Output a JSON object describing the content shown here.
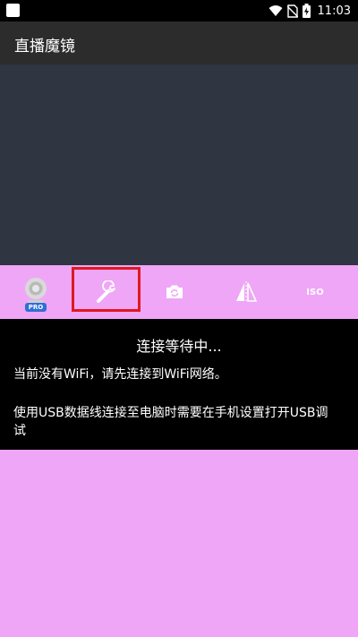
{
  "status_bar": {
    "time": "11:03",
    "icons": [
      "wifi-icon",
      "no-sim-icon",
      "battery-charging-icon"
    ]
  },
  "app_bar": {
    "title": "直播魔镜"
  },
  "toolbar": {
    "items": [
      {
        "name": "webcam-pro-icon",
        "badge": "PRO"
      },
      {
        "name": "wrench-icon",
        "selected": true
      },
      {
        "name": "camera-switch-icon"
      },
      {
        "name": "mirror-flip-icon"
      },
      {
        "name": "iso-button",
        "label": "ISO"
      }
    ],
    "highlight_color": "#e0191f"
  },
  "message": {
    "title": "连接等待中...",
    "line1": "当前没有WiFi，请先连接到WiFi网络。",
    "line2": "使用USB数据线连接至电脑时需要在手机设置打开USB调试"
  },
  "colors": {
    "toolbar_bg": "#efa6f7",
    "preview_bg": "#2f3541",
    "app_bar_bg": "#2c2c2c",
    "panel_bg": "#000000"
  }
}
